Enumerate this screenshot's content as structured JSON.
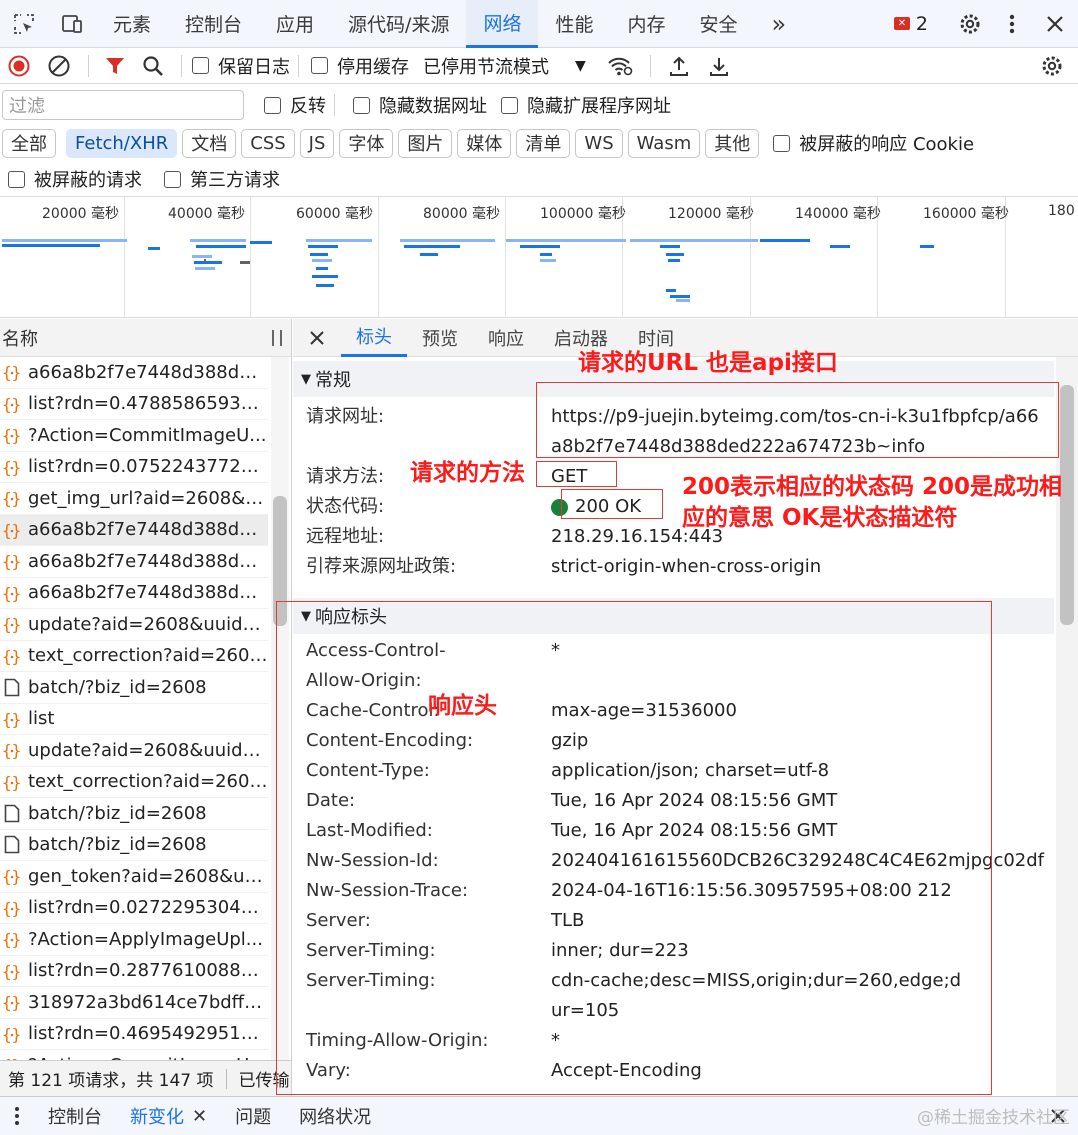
{
  "top_tabs": [
    {
      "label": "元素"
    },
    {
      "label": "控制台"
    },
    {
      "label": "应用"
    },
    {
      "label": "源代码/来源"
    },
    {
      "label": "网络"
    },
    {
      "label": "性能"
    },
    {
      "label": "内存"
    },
    {
      "label": "安全"
    }
  ],
  "topbar": {
    "more_label": "»",
    "issue_count": "2"
  },
  "toolbar": {
    "preserve_log": "保留日志",
    "disable_cache": "停用缓存",
    "throttling": "已停用节流模式"
  },
  "filter": {
    "placeholder": "过滤",
    "invert": "反转",
    "hide_data_urls": "隐藏数据网址",
    "hide_ext_urls": "隐藏扩展程序网址",
    "blocked_cookies": "被屏蔽的响应 Cookie",
    "blocked_requests": "被屏蔽的请求",
    "third_party": "第三方请求"
  },
  "type_chips": [
    "全部",
    "Fetch/XHR",
    "文档",
    "CSS",
    "JS",
    "字体",
    "图片",
    "媒体",
    "清单",
    "WS",
    "Wasm",
    "其他"
  ],
  "timeline": {
    "ticks": [
      "20000 毫秒",
      "40000 毫秒",
      "60000 毫秒",
      "80000 毫秒",
      "100000 毫秒",
      "120000 毫秒",
      "140000 毫秒",
      "160000 毫秒",
      "180"
    ]
  },
  "request_list": {
    "header": "名称",
    "rows": [
      {
        "name": "a66a8b2f7e7448d388ded...",
        "type": "xhr"
      },
      {
        "name": "list?rdn=0.478858659329...",
        "type": "xhr"
      },
      {
        "name": "?Action=CommitImageU...",
        "type": "xhr"
      },
      {
        "name": "list?rdn=0.075224377226...",
        "type": "xhr"
      },
      {
        "name": "get_img_url?aid=2608&u...",
        "type": "xhr"
      },
      {
        "name": "a66a8b2f7e7448d388ded...",
        "type": "xhr",
        "selected": true
      },
      {
        "name": "a66a8b2f7e7448d388ded...",
        "type": "xhr"
      },
      {
        "name": "a66a8b2f7e7448d388ded...",
        "type": "xhr"
      },
      {
        "name": "update?aid=2608&uuid=...",
        "type": "xhr"
      },
      {
        "name": "text_correction?aid=2608...",
        "type": "xhr"
      },
      {
        "name": "batch/?biz_id=2608",
        "type": "doc"
      },
      {
        "name": "list",
        "type": "xhr"
      },
      {
        "name": "update?aid=2608&uuid=...",
        "type": "xhr"
      },
      {
        "name": "text_correction?aid=2608...",
        "type": "xhr"
      },
      {
        "name": "batch/?biz_id=2608",
        "type": "doc"
      },
      {
        "name": "batch/?biz_id=2608",
        "type": "doc"
      },
      {
        "name": "gen_token?aid=2608&uu...",
        "type": "xhr"
      },
      {
        "name": "list?rdn=0.027229530452...",
        "type": "xhr"
      },
      {
        "name": "?Action=ApplyImageUpl...",
        "type": "xhr"
      },
      {
        "name": "list?rdn=0.287761008814...",
        "type": "xhr"
      },
      {
        "name": "318972a3bd614ce7bdff8...",
        "type": "xhr"
      },
      {
        "name": "list?rdn=0.469549295117...",
        "type": "xhr"
      },
      {
        "name": "?Action=CommitImageU...",
        "type": "xhr"
      }
    ],
    "footer": "第 121 项请求，共 147 项",
    "footer_more": "已传输"
  },
  "detail_tabs": [
    "标头",
    "预览",
    "响应",
    "启动器",
    "时间"
  ],
  "general": {
    "title": "常规",
    "fields": [
      {
        "key": "请求网址:",
        "value": "https://p9-juejin.byteimg.com/tos-cn-i-k3u1fbpfcp/a66a8b2f7e7448d388ded222a674723b~info"
      },
      {
        "key": "请求方法:",
        "value": "GET"
      },
      {
        "key": "状态代码:",
        "value": "200 OK"
      },
      {
        "key": "远程地址:",
        "value": "218.29.16.154:443"
      },
      {
        "key": "引荐来源网址政策:",
        "value": "strict-origin-when-cross-origin"
      }
    ],
    "status_color": "#188038"
  },
  "response_headers": {
    "title": "响应标头",
    "fields": [
      {
        "key": "Access-Control-Allow-Origin:",
        "value": "*"
      },
      {
        "key": "Cache-Control:",
        "value": "max-age=31536000"
      },
      {
        "key": "Content-Encoding:",
        "value": "gzip"
      },
      {
        "key": "Content-Type:",
        "value": "application/json; charset=utf-8"
      },
      {
        "key": "Date:",
        "value": "Tue, 16 Apr 2024 08:15:56 GMT"
      },
      {
        "key": "Last-Modified:",
        "value": "Tue, 16 Apr 2024 08:15:56 GMT"
      },
      {
        "key": "Nw-Session-Id:",
        "value": "202404161615560DCB26C329248C4C4E62mjpgc02df"
      },
      {
        "key": "Nw-Session-Trace:",
        "value": "2024-04-16T16:15:56.30957595+08:00 212"
      },
      {
        "key": "Server:",
        "value": "TLB"
      },
      {
        "key": "Server-Timing:",
        "value": "inner; dur=223"
      },
      {
        "key": "Server-Timing:",
        "value": "cdn-cache;desc=MISS,origin;dur=260,edge;dur=105"
      },
      {
        "key": "Timing-Allow-Origin:",
        "value": "*"
      },
      {
        "key": "Vary:",
        "value": "Accept-Encoding"
      }
    ]
  },
  "annotations": {
    "url": "请求的URL 也是api接口",
    "method": "请求的方法",
    "status_line1": "200表示相应的状态码 200是成功相",
    "status_line2": "应的意思 OK是状态描述符",
    "headers": "响应头",
    "color": "#ff1a1a"
  },
  "drawer": {
    "tabs": [
      "控制台",
      "新变化",
      "问题",
      "网络状况"
    ]
  },
  "watermark": "@稀土掘金技术社区"
}
